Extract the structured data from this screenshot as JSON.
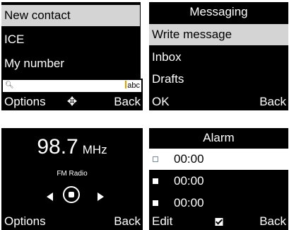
{
  "contacts": {
    "items": [
      {
        "label": "New contact",
        "selected": true
      },
      {
        "label": "ICE",
        "selected": false
      },
      {
        "label": "My number",
        "selected": false
      }
    ],
    "search": {
      "icon": "search-icon",
      "input_mode": "abc"
    },
    "softkeys": {
      "left": "Options",
      "center": "✥",
      "right": "Back"
    }
  },
  "messaging": {
    "title": "Messaging",
    "items": [
      {
        "label": "Write message",
        "selected": true
      },
      {
        "label": "Inbox",
        "selected": false
      },
      {
        "label": "Drafts",
        "selected": false
      }
    ],
    "softkeys": {
      "left": "OK",
      "right": "Back"
    }
  },
  "radio": {
    "frequency": "98.7",
    "unit": "MHz",
    "label": "FM Radio",
    "controls": [
      "previous-icon",
      "stop-icon",
      "next-icon"
    ],
    "softkeys": {
      "left": "Options",
      "right": "Back"
    }
  },
  "alarm": {
    "title": "Alarm",
    "items": [
      {
        "time": "00:00",
        "selected": true
      },
      {
        "time": "00:00",
        "selected": false
      },
      {
        "time": "00:00",
        "selected": false
      }
    ],
    "softkeys": {
      "left": "Edit",
      "center_icon": "checkbox-icon",
      "right": "Back"
    }
  },
  "colors": {
    "screen_bg": "#000000",
    "highlight": "#d4d4d4",
    "text": "#ffffff"
  }
}
